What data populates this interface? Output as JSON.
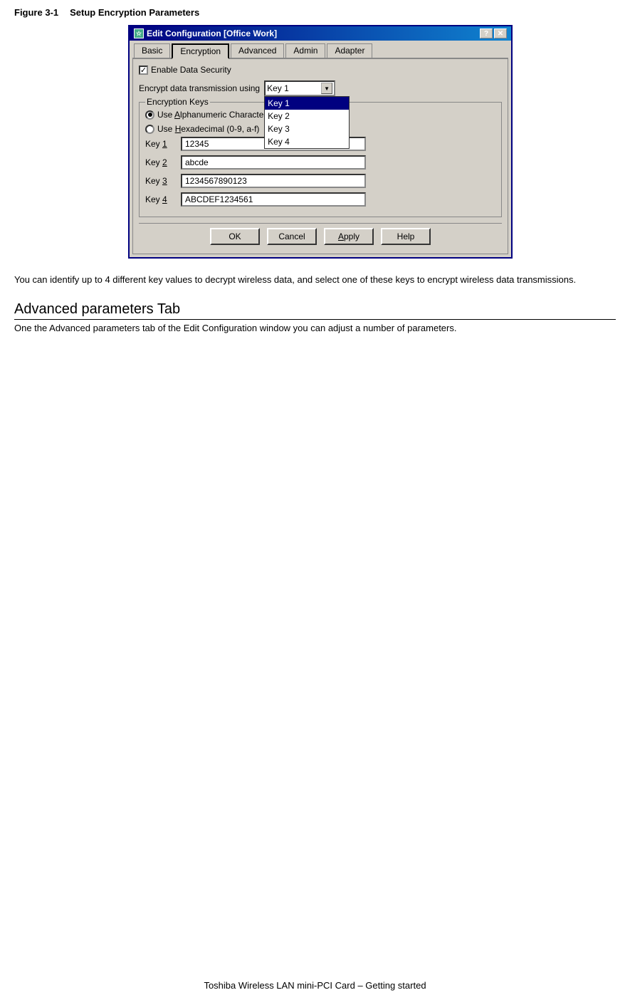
{
  "figure": {
    "label": "Figure 3-1",
    "title": "Setup Encryption Parameters"
  },
  "dialog": {
    "title": "Edit Configuration [Office Work]",
    "titlebar_icon": "☆",
    "titlebar_buttons": [
      "?",
      "✕"
    ],
    "tabs": [
      {
        "label": "Basic",
        "active": false
      },
      {
        "label": "Encryption",
        "active": true
      },
      {
        "label": "Advanced",
        "active": false
      },
      {
        "label": "Admin",
        "active": false
      },
      {
        "label": "Adapter",
        "active": false
      }
    ],
    "enable_security_label": "Enable Data Security",
    "encrypt_label": "Encrypt data transmission using",
    "dropdown": {
      "selected": "Key 1",
      "options": [
        "Key 1",
        "Key 2",
        "Key 3",
        "Key 4"
      ]
    },
    "group_label": "Encryption Keys",
    "radio_options": [
      {
        "label": "Use Alphanumeric Characters",
        "checked": true
      },
      {
        "label": "Use Hexadecimal (0-9, a-f)",
        "checked": false
      }
    ],
    "keys": [
      {
        "label": "Key 1",
        "underline": "1",
        "value": "12345"
      },
      {
        "label": "Key 2",
        "underline": "2",
        "value": "abcde"
      },
      {
        "label": "Key 3",
        "underline": "3",
        "value": "1234567890123"
      },
      {
        "label": "Key 4",
        "underline": "4",
        "value": "ABCDEF1234561"
      }
    ],
    "buttons": [
      "OK",
      "Cancel",
      "Apply",
      "Help"
    ]
  },
  "body_text": "You can identify up to 4 different key values to decrypt wireless data, and select one of these keys to encrypt wireless data transmissions.",
  "section": {
    "heading": "Advanced parameters Tab",
    "body": "One the Advanced parameters tab of the Edit Configuration window you can adjust a number of parameters."
  },
  "footer": "Toshiba Wireless LAN mini-PCI Card – Getting started"
}
